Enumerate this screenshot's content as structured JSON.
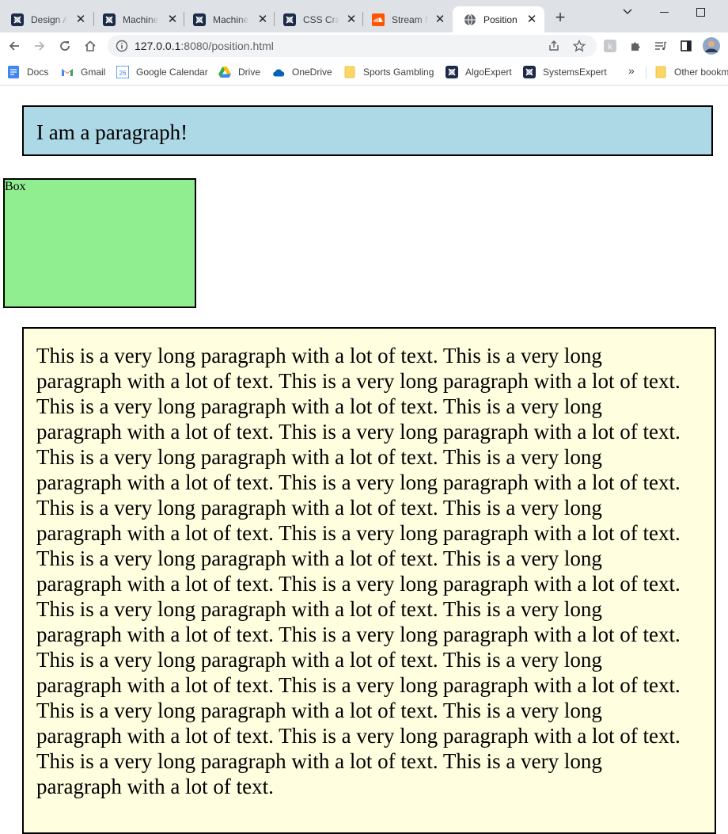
{
  "tabs": [
    {
      "label": "Design A",
      "icon": "algoexpert-icon"
    },
    {
      "label": "Machine",
      "icon": "algoexpert-icon"
    },
    {
      "label": "Machine",
      "icon": "algoexpert-icon"
    },
    {
      "label": "CSS Crash",
      "icon": "algoexpert-icon"
    },
    {
      "label": "Stream M",
      "icon": "soundcloud-icon"
    },
    {
      "label": "Position",
      "icon": "globe-icon",
      "active": true
    }
  ],
  "omnibox": {
    "host": "127.0.0.1",
    "path": ":8080/position.html"
  },
  "bookmarks": [
    {
      "label": "Docs",
      "icon": "docs-icon"
    },
    {
      "label": "Gmail",
      "icon": "gmail-icon"
    },
    {
      "label": "Google Calendar",
      "icon": "calendar-icon",
      "badge": "26"
    },
    {
      "label": "Drive",
      "icon": "drive-icon"
    },
    {
      "label": "OneDrive",
      "icon": "onedrive-icon"
    },
    {
      "label": "Sports Gambling",
      "icon": "folder-icon"
    },
    {
      "label": "AlgoExpert",
      "icon": "algoexpert-icon"
    },
    {
      "label": "SystemsExpert",
      "icon": "algoexpert-icon"
    }
  ],
  "bookmarks_more": "»",
  "other_bookmarks": "Other bookmarks",
  "page": {
    "paragraph": "I am a paragraph!",
    "box": "Box",
    "long_paragraph": "This is a very long paragraph with a lot of text. This is a very long paragraph with a lot of text. This is a very long paragraph with a lot of text. This is a very long paragraph with a lot of text. This is a very long paragraph with a lot of text. This is a very long paragraph with a lot of text. This is a very long paragraph with a lot of text. This is a very long paragraph with a lot of text. This is a very long paragraph with a lot of text. This is a very long paragraph with a lot of text. This is a very long paragraph with a lot of text. This is a very long paragraph with a lot of text. This is a very long paragraph with a lot of text. This is a very long paragraph with a lot of text. This is a very long paragraph with a lot of text. This is a very long paragraph with a lot of text. This is a very long paragraph with a lot of text. This is a very long paragraph with a lot of text. This is a very long paragraph with a lot of text. This is a very long paragraph with a lot of text. This is a very long paragraph with a lot of text. This is a very long paragraph with a lot of text. This is a very long paragraph with a lot of text. This is a very long paragraph with a lot of text. This is a very long paragraph with a lot of text. This is a very long paragraph with a lot of text."
  },
  "colors": {
    "paragraph_bg": "#add8e6",
    "box_bg": "#90ee90",
    "long_paragraph_bg": "#ffffe0",
    "tabstrip_bg": "#dee1e6"
  }
}
